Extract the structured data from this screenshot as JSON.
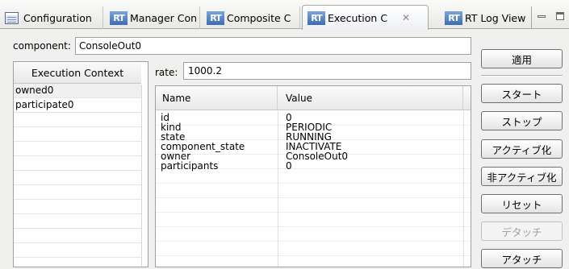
{
  "tabs": [
    {
      "label": "Configuration",
      "icon": "configuration-icon"
    },
    {
      "label": "Manager Con",
      "icon": "rt-icon"
    },
    {
      "label": "Composite C",
      "icon": "rt-icon"
    },
    {
      "label": "Execution C",
      "icon": "rt-icon",
      "active": true
    },
    {
      "label": "RT Log View",
      "icon": "rt-icon"
    }
  ],
  "rt_icon_text": "RT",
  "close_glyph": "✕",
  "component": {
    "label": "component:",
    "value": "ConsoleOut0"
  },
  "execution_context": {
    "header": "Execution Context",
    "items": [
      "owned0",
      "participate0"
    ]
  },
  "rate": {
    "label": "rate:",
    "value": "1000.2"
  },
  "properties": {
    "columns": [
      "Name",
      "Value"
    ],
    "rows": [
      {
        "name": "id",
        "value": "0"
      },
      {
        "name": "kind",
        "value": "PERIODIC"
      },
      {
        "name": "state",
        "value": "RUNNING"
      },
      {
        "name": "component_state",
        "value": "INACTIVATE"
      },
      {
        "name": "owner",
        "value": "ConsoleOut0"
      },
      {
        "name": "participants",
        "value": "0"
      }
    ]
  },
  "buttons": {
    "apply": "適用",
    "start": "スタート",
    "stop": "ストップ",
    "activate": "アクティブ化",
    "deactivate": "非アクティブ化",
    "reset": "リセット",
    "detach": "デタッチ",
    "attach": "アタッチ"
  }
}
